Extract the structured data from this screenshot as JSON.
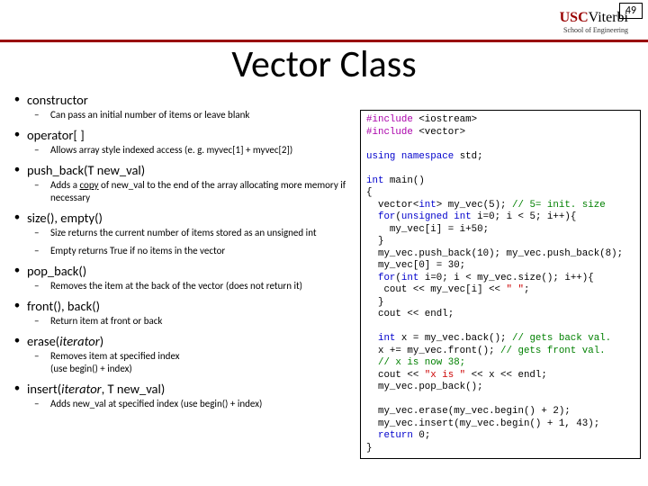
{
  "page_number": "49",
  "logo": {
    "usc": "USC",
    "viterbi": "Viterbi",
    "sub": "School of Engineering"
  },
  "title": "Vector Class",
  "items": [
    {
      "method": "constructor",
      "sub": [
        "Can pass an initial number of items or leave blank"
      ]
    },
    {
      "method": "operator[ ]",
      "sub": [
        "Allows array style indexed access (e. g. myvec[1] + myvec[2])"
      ]
    },
    {
      "method": "push_back(T new_val)",
      "sub": [
        "Adds a copy of new_val to the end of the array allocating more memory if necessary"
      ]
    },
    {
      "method": "size(), empty()",
      "sub": [
        "Size returns the current number of items stored as an unsigned int",
        "Empty returns True if no items in the vector"
      ]
    },
    {
      "method": "pop_back()",
      "sub": [
        "Removes the item at the back of the vector (does not return it)"
      ]
    },
    {
      "method": "front(), back()",
      "sub": [
        "Return item at front or back"
      ]
    },
    {
      "method": "erase(iterator)",
      "italic": true,
      "sub": [
        "Removes item at specified index (use begin() + index)"
      ]
    },
    {
      "method": "insert(iterator, T new_val)",
      "italic": true,
      "sub": [
        "Adds new_val at specified index (use begin() + index)"
      ]
    }
  ],
  "code": {
    "l01a": "#include",
    "l01b": " <iostream>",
    "l02a": "#include",
    "l02b": " <vector>",
    "blank1": "",
    "l03a": "using",
    "l03b": " ",
    "l03c": "namespace",
    "l03d": " std;",
    "blank2": "",
    "l04a": "int",
    "l04b": " main()",
    "l05": "{",
    "l06": "  vector<",
    "l06a": "int",
    "l06b": "> my_vec(5); ",
    "l06c": "// 5= init. size",
    "l07a": "  ",
    "l07b": "for",
    "l07c": "(",
    "l07d": "unsigned",
    "l07e": " ",
    "l07f": "int",
    "l07g": " i=0; i < 5; i++){",
    "l08": "    my_vec[i] = i+50;",
    "l09": "  }",
    "l10": "  my_vec.push_back(10); my_vec.push_back(8);",
    "l11": "  my_vec[0] = 30;",
    "l12a": "  ",
    "l12b": "for",
    "l12c": "(",
    "l12d": "int",
    "l12e": " i=0; i < my_vec.size(); i++){",
    "l13a": "   cout << my_vec[i] << ",
    "l13b": "\" \"",
    "l13c": ";",
    "l14": "  }",
    "l15": "  cout << endl;",
    "blank3": "",
    "l16a": "  ",
    "l16b": "int",
    "l16c": " x = my_vec.back(); ",
    "l16d": "// gets back val.",
    "l17a": "  x += my_vec.front(); ",
    "l17b": "// gets front val.",
    "l18": "  // x is now 38;",
    "l19a": "  cout << ",
    "l19b": "\"x is \"",
    "l19c": " << x << endl;",
    "l20": "  my_vec.pop_back();",
    "blank4": "",
    "l21": "  my_vec.erase(my_vec.begin() + 2);",
    "l22": "  my_vec.insert(my_vec.begin() + 1, 43);",
    "l23a": "  ",
    "l23b": "return",
    "l23c": " 0;",
    "l24": "}"
  }
}
